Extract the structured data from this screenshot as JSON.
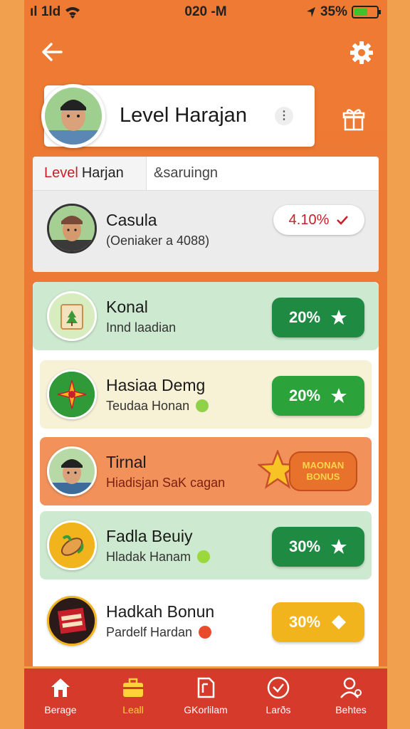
{
  "status_bar": {
    "signal": "ıl 1ld",
    "time": "020 -M",
    "battery_percent": "35%"
  },
  "header": {
    "title": "Level Harajan"
  },
  "tabs": [
    {
      "prefix": "Level",
      "label": "Harjan"
    },
    {
      "label": "&saruingn"
    }
  ],
  "profile": {
    "name": "Casula",
    "subtitle": "(Oeniaker a 4088)",
    "score": "4.10%"
  },
  "list": [
    {
      "title": "Konal",
      "subtitle": "Innd laadian",
      "value": "20%",
      "button_color": "#1e8a42",
      "icon": "star-icon"
    },
    {
      "title": "Hasiaa Demg",
      "subtitle": "Teudaa Honan",
      "value": "20%",
      "button_color": "#2ba33a",
      "icon": "star-icon"
    },
    {
      "title": "Tirnal",
      "subtitle": "Hiadisjan SaK cagan",
      "bonus_line1": "MAONAN",
      "bonus_line2": "BONUS"
    },
    {
      "title": "Fadla Beuiy",
      "subtitle": "Hladak Hanam",
      "value": "30%",
      "button_color": "#1e8a42",
      "icon": "star-icon"
    },
    {
      "title": "Hadkah Bonun",
      "subtitle": "Pardelf Hardan",
      "value": "30%",
      "button_color": "#f2b41c",
      "icon": "diamond-icon"
    }
  ],
  "nav": [
    {
      "label": "Berage",
      "icon": "home-icon"
    },
    {
      "label": "Leall",
      "icon": "briefcase-icon",
      "active": true
    },
    {
      "label": "GKorlilam",
      "icon": "document-icon"
    },
    {
      "label": "Larðs",
      "icon": "check-circle-icon"
    },
    {
      "label": "Behtes",
      "icon": "user-icon"
    }
  ],
  "colors": {
    "background": "#ee7a33",
    "nav": "#d53a2a",
    "green": "#1e8a42",
    "yellow": "#f2b41c"
  }
}
